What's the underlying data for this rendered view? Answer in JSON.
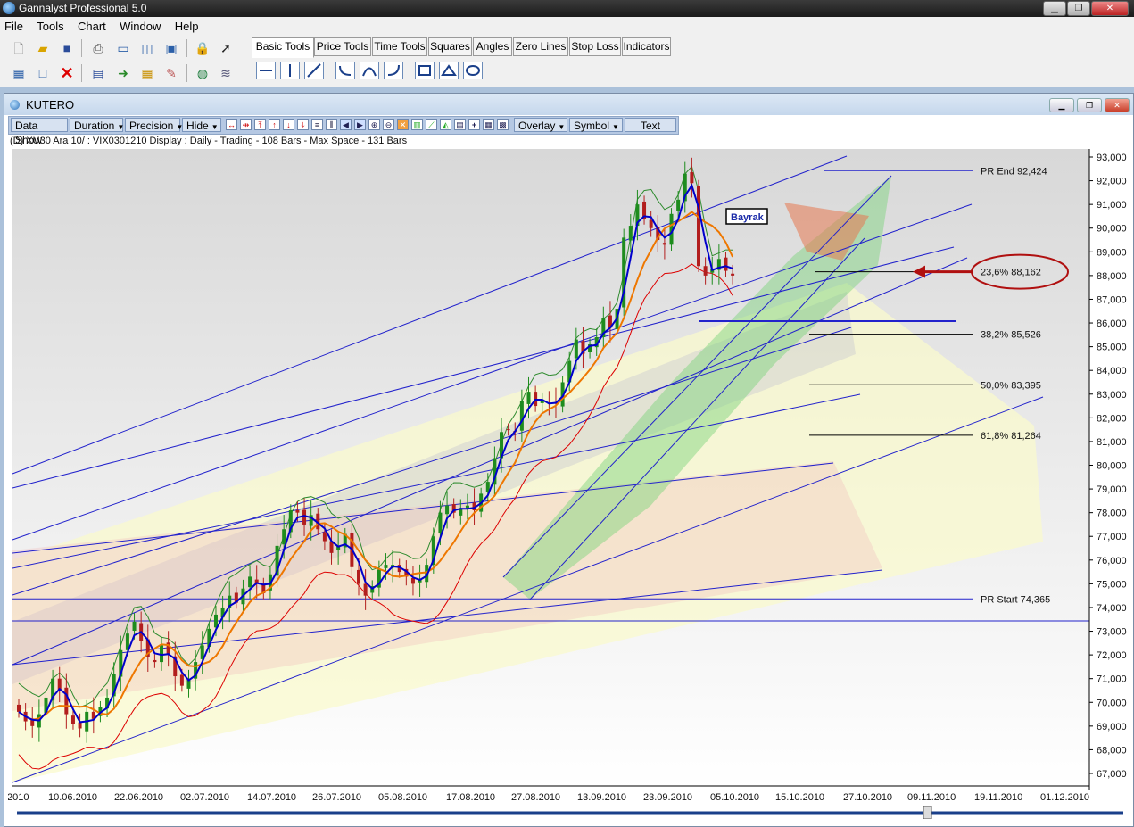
{
  "app": {
    "title": "Gannalyst Professional 5.0",
    "window_buttons": {
      "minimize": "▁",
      "maximize": "❐",
      "close": "✕"
    }
  },
  "menu": [
    "File",
    "Tools",
    "Chart",
    "Window",
    "Help"
  ],
  "toolbar_icons": {
    "row1": [
      "new-icon",
      "open-icon",
      "save-icon",
      "print-icon",
      "window-h-icon",
      "window-v-icon",
      "image-icon",
      "lock-icon",
      "pointer-icon"
    ],
    "row2": [
      "calculator-icon",
      "square-icon",
      "delete-icon",
      "film-icon",
      "export-icon",
      "grid-icon",
      "chart-edit-icon",
      "globe-icon",
      "layers-icon"
    ]
  },
  "tabs": [
    {
      "label": "Basic Tools",
      "active": true
    },
    {
      "label": "Price Tools",
      "active": false
    },
    {
      "label": "Time Tools",
      "active": false
    },
    {
      "label": "Squares",
      "active": false
    },
    {
      "label": "Angles",
      "active": false
    },
    {
      "label": "Zero Lines",
      "active": false
    },
    {
      "label": "Stop Loss",
      "active": false
    },
    {
      "label": "Indicators",
      "active": false
    }
  ],
  "draw_tools": [
    "horizontal-line-icon",
    "vertical-line-icon",
    "trend-line-icon",
    "arc-left-icon",
    "arc-top-icon",
    "arc-right-icon",
    "rectangle-icon",
    "triangle-icon",
    "ellipse-icon"
  ],
  "chart_window": {
    "title": "KUTERO",
    "toolbar": {
      "data_show": "Data Show",
      "duration": "Duration",
      "precision": "Precision",
      "hide": "Hide",
      "overlay": "Overlay",
      "symbol": "Symbol",
      "text": "Text"
    },
    "info_line": "(D) XU30 Ara 10/ : VIX0301210 Display :  Daily  - Trading - 108 Bars -  Max Space - 131 Bars"
  },
  "annotation": {
    "label": "Bayrak"
  },
  "colors": {
    "up": "#1E8C1E",
    "down": "#B21E1E",
    "ma_fast": "#0000CC",
    "ma_slow": "#EE7700",
    "band": "#DD0000",
    "envelope": "#2E8B2E",
    "gann": "#2222CC"
  },
  "chart_data": {
    "type": "candlestick",
    "y_axis": {
      "min": 66500,
      "max": 93000,
      "ticks": [
        "93,000",
        "92,000",
        "91,000",
        "90,000",
        "89,000",
        "88,000",
        "87,000",
        "86,000",
        "85,000",
        "84,000",
        "83,000",
        "82,000",
        "81,000",
        "80,000",
        "79,000",
        "78,000",
        "77,000",
        "76,000",
        "75,000",
        "74,000",
        "73,000",
        "72,000",
        "71,000",
        "70,000",
        "69,000",
        "68,000",
        "67,000"
      ]
    },
    "x_axis": {
      "ticks": [
        ".2010",
        "10.06.2010",
        "22.06.2010",
        "02.07.2010",
        "14.07.2010",
        "26.07.2010",
        "05.08.2010",
        "17.08.2010",
        "27.08.2010",
        "13.09.2010",
        "23.09.2010",
        "05.10.2010",
        "15.10.2010",
        "27.10.2010",
        "09.11.2010",
        "19.11.2010",
        "01.12.2010"
      ]
    },
    "levels": [
      {
        "label": "PR End 92,424",
        "value": 92424
      },
      {
        "label": "23,6% 88,162",
        "value": 88162
      },
      {
        "label": "38,2% 85,526",
        "value": 85526
      },
      {
        "label": "50,0% 83,395",
        "value": 83395
      },
      {
        "label": "61,8% 81,264",
        "value": 81264
      },
      {
        "label": "PR Start 74,365",
        "value": 74365
      }
    ],
    "close": [
      69600,
      69200,
      69000,
      69500,
      70200,
      71000,
      70500,
      69500,
      69100,
      68900,
      69600,
      69300,
      69800,
      70200,
      71200,
      72200,
      72900,
      73400,
      72600,
      71900,
      71700,
      72400,
      72000,
      71100,
      70700,
      71000,
      71700,
      72400,
      73100,
      73700,
      74000,
      74500,
      74200,
      74800,
      75300,
      75000,
      74600,
      75400,
      76600,
      77300,
      78100,
      78000,
      77500,
      77900,
      77300,
      76800,
      76300,
      76600,
      77100,
      75700,
      75000,
      74500,
      74900,
      75600,
      75800,
      75800,
      75500,
      75300,
      75000,
      75200,
      75800,
      77000,
      78000,
      78300,
      78000,
      78200,
      78300,
      78100,
      78800,
      79300,
      80300,
      81400,
      81500,
      81400,
      82700,
      83100,
      82500,
      82700,
      82600,
      82600,
      83500,
      84400,
      85300,
      84700,
      85100,
      85400,
      86200,
      85800,
      86600,
      89600,
      90100,
      91000,
      90400,
      90000,
      89500,
      89300,
      90600,
      91200,
      92300,
      91900,
      88400,
      88000,
      88300,
      88700,
      88200,
      88000
    ]
  }
}
